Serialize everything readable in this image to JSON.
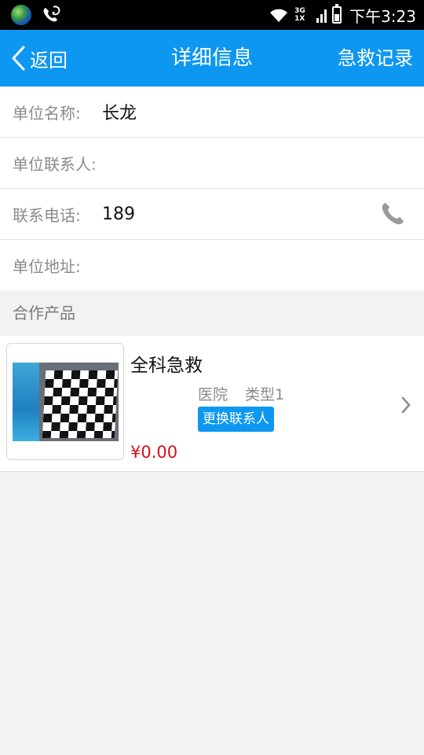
{
  "status_bar": {
    "network_label_1": "3G",
    "network_label_2": "1X",
    "time": "下午3:23",
    "icons": [
      "globe-icon",
      "phone-missed-icon",
      "wifi-icon",
      "signal-icon",
      "battery-icon"
    ]
  },
  "nav": {
    "back_label": "返回",
    "title": "详细信息",
    "right_label": "急救记录"
  },
  "info": {
    "rows": [
      {
        "label": "单位名称:",
        "value": "长龙"
      },
      {
        "label": "单位联系人:",
        "value": ""
      },
      {
        "label": "联系电话:",
        "value": "189"
      },
      {
        "label": "单位地址:",
        "value": ""
      }
    ]
  },
  "section": {
    "products_title": "合作产品"
  },
  "product": {
    "name": "全科急救",
    "meta_1": "医院",
    "meta_2": "类型1",
    "change_button": "更换联系人",
    "price": "¥0.00"
  },
  "colors": {
    "accent": "#0d97f0",
    "price": "#d0121b",
    "label_gray": "#8a8a8a",
    "background": "#f2f2f2"
  }
}
